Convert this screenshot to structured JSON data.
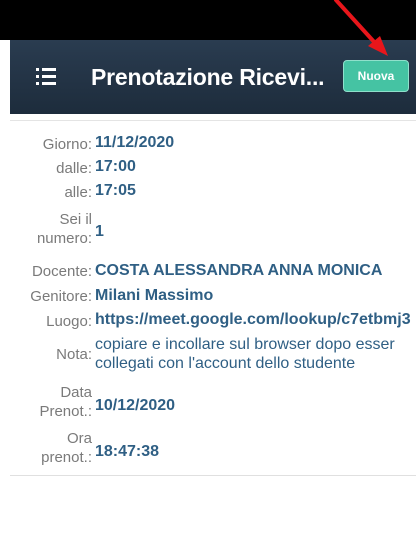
{
  "header": {
    "title": "Prenotazione Ricevi...",
    "new_button_label": "Nuova"
  },
  "details": {
    "giorno": {
      "label": "Giorno:",
      "value": "11/12/2020"
    },
    "dalle": {
      "label": "dalle:",
      "value": "17:00"
    },
    "alle": {
      "label": "alle:",
      "value": "17:05"
    },
    "numero": {
      "label_line1": "Sei il",
      "label_line2": "numero:",
      "value": "1"
    },
    "docente": {
      "label": "Docente:",
      "value": "COSTA ALESSANDRA ANNA MONICA"
    },
    "genitore": {
      "label": "Genitore:",
      "value": "Milani Massimo"
    },
    "luogo": {
      "label": "Luogo:",
      "value": "https://meet.google.com/lookup/c7etbmj3"
    },
    "nota": {
      "label": "Nota:",
      "value_line1": "copiare e incollare sul browser dopo esser",
      "value_line2": "collegati con l'account dello studente"
    },
    "data_prenot": {
      "label_line1": "Data",
      "label_line2": "Prenot.:",
      "value": "10/12/2020"
    },
    "ora_prenot": {
      "label_line1": "Ora",
      "label_line2": "prenot.:",
      "value": "18:47:38"
    }
  },
  "colors": {
    "header_bg": "#1d2c3c",
    "accent_button": "#45c3a3",
    "value_text": "#2f5f84",
    "label_text": "#7a7a7a",
    "annotation_arrow": "#e8161b"
  }
}
